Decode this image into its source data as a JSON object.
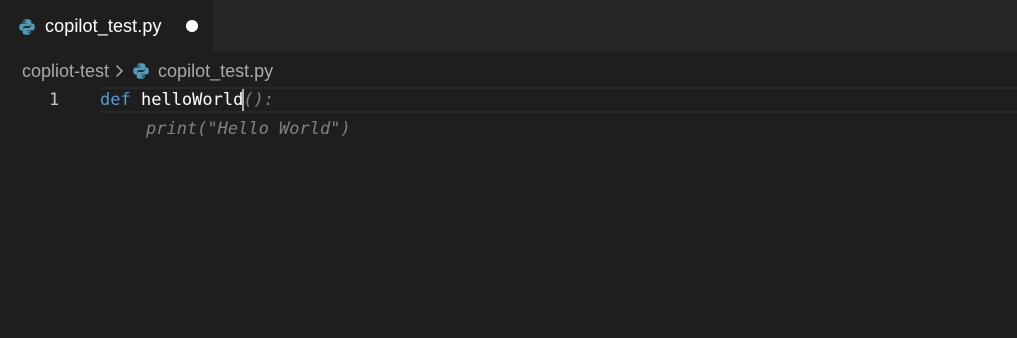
{
  "tab": {
    "title": "copilot_test.py",
    "icon": "python-file-icon",
    "unsaved": true
  },
  "breadcrumb": {
    "folder": "copliot-test",
    "separator_icon": "chevron-right-icon",
    "file_icon": "python-file-icon",
    "file": "copilot_test.py"
  },
  "editor": {
    "line_numbers": [
      "1"
    ],
    "line1": {
      "keyword": "def",
      "function_name": "helloWorld",
      "ghost_suffix": "():"
    },
    "line2_ghost": "print(\"Hello World\")"
  },
  "colors": {
    "editor_background": "#1e1e1e",
    "tabbar_background": "#252526",
    "keyword": "#569cd6",
    "ghost_text": "#808080"
  }
}
